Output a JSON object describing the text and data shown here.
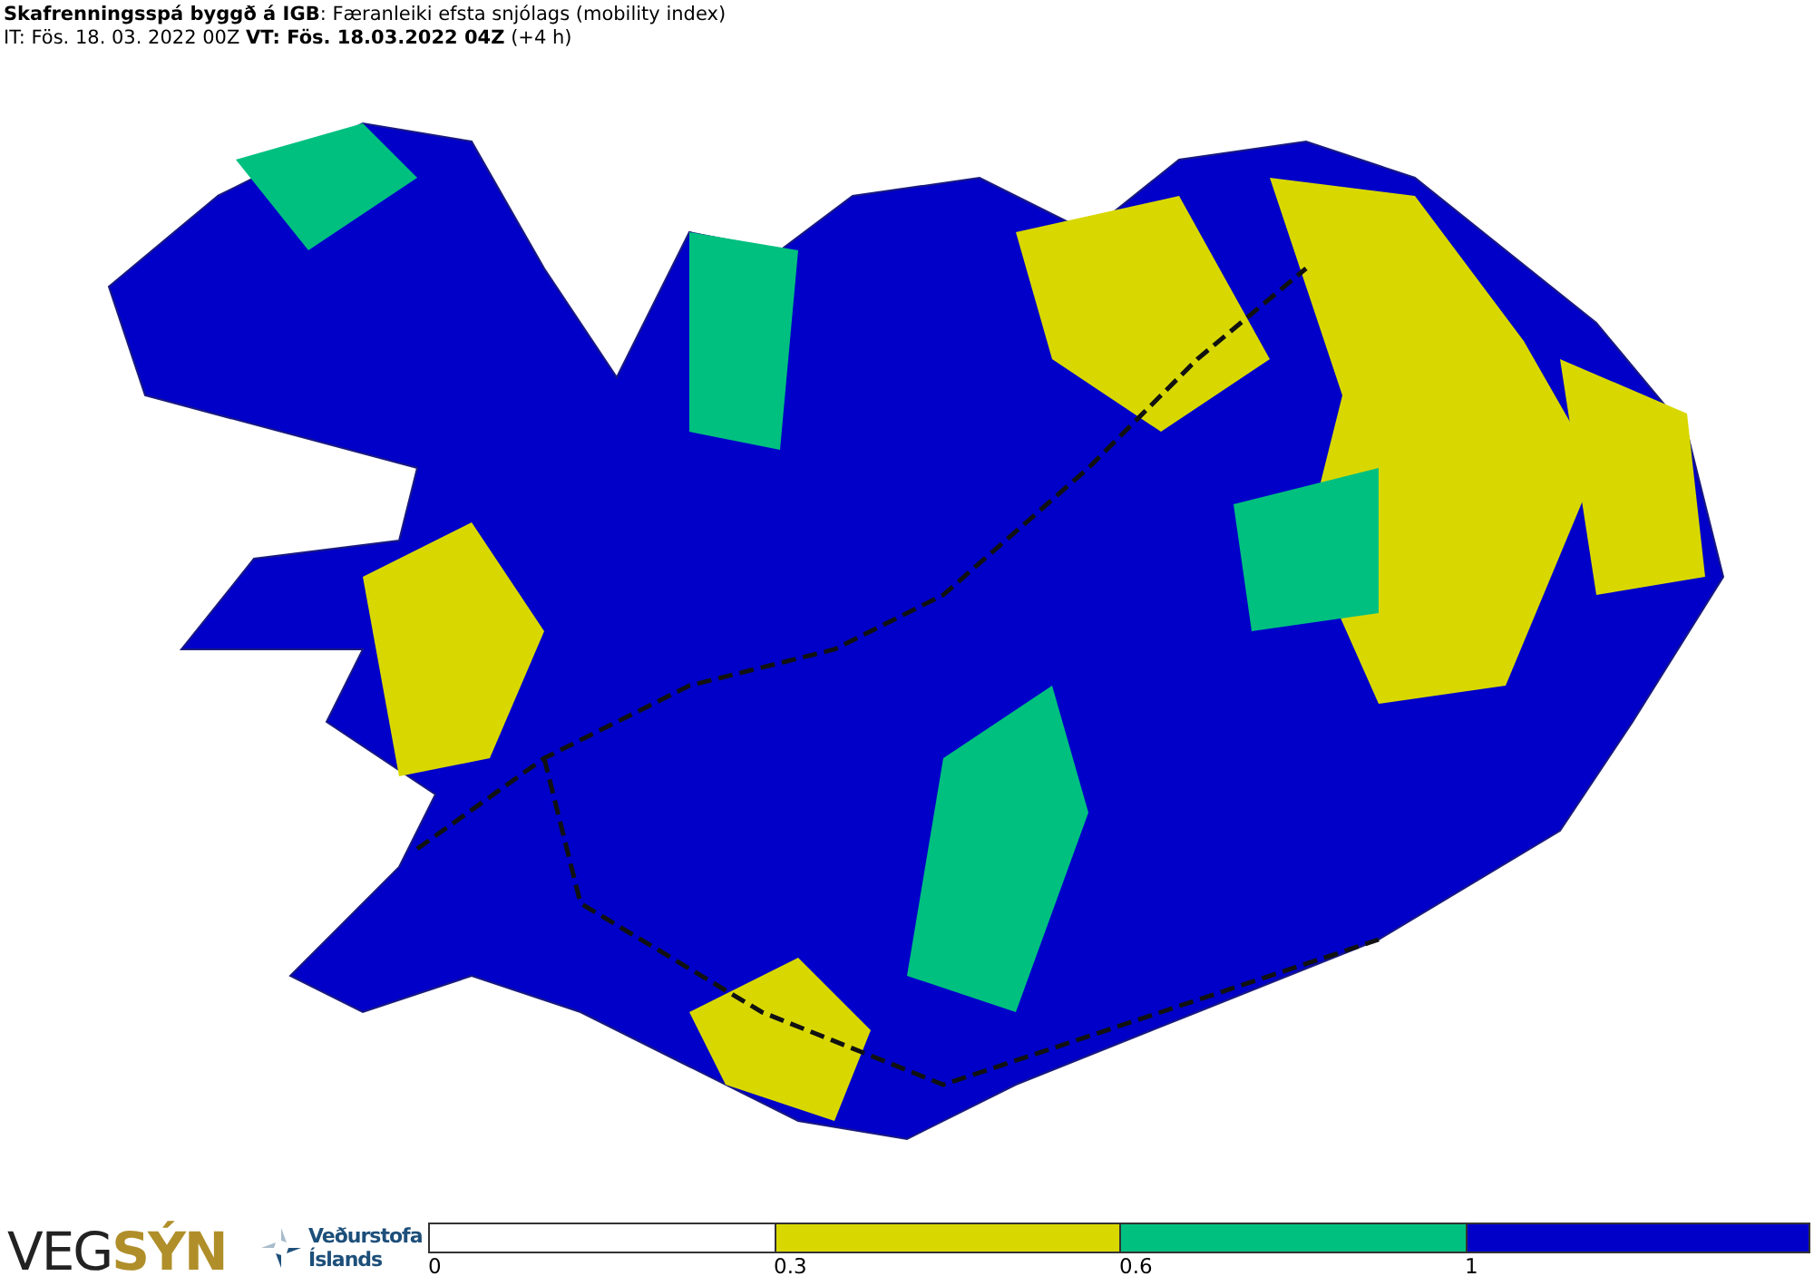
{
  "header": {
    "title": "**Skafrenningsspá byggð á IGB**: Færanleiki efsta snjólags (mobility index)",
    "subtitle": "IT: Fös. 18. 03. 2022 00Z **VT: Fös. 18.03.2022 04Z** (+4 h)"
  },
  "footer": {
    "vegsyn_logo": "VEG**SÝN**",
    "vedur_logo": [
      "Veðurstofa",
      "Íslands"
    ],
    "legend": [
      {
        "label": "0",
        "color": "#ffffff"
      },
      {
        "label": "0.3",
        "color": "#d8d800"
      },
      {
        "label": "0.6",
        "color": "#00c080"
      },
      {
        "label": "1",
        "color": "#0000c8"
      }
    ]
  }
}
